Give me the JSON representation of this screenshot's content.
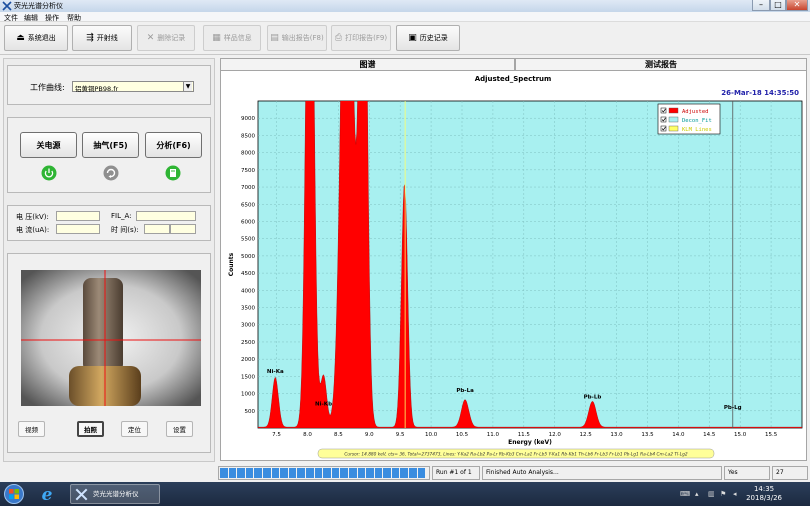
{
  "window": {
    "title": "荧光光谱分析仪",
    "minimize": "–",
    "maximize": "□",
    "close": "✕"
  },
  "menu": [
    "文件",
    "编辑",
    "操作",
    "帮助"
  ],
  "toolbar": {
    "system_exit": "系统退出",
    "xray_on": "开射线",
    "delete_record": "删除记录",
    "sample_info": "样品信息",
    "export_report": "输出报告(F8)",
    "print_report": "打印报告(F9)",
    "history": "历史记录"
  },
  "left": {
    "curve_label": "工作曲线:",
    "curve_value": "铝黄铜PB98.fr",
    "power_off": "关电源",
    "pump": "抽气(F5)",
    "analyze": "分析(F6)",
    "voltage_label": "电 压(kV):",
    "current_label": "电 流(uA):",
    "fil_label": "FIL_A:",
    "time_label": "时 间(s):",
    "video": "视频",
    "photo": "拍照",
    "locate": "定位",
    "settings": "设置"
  },
  "tabs": {
    "spectrum": "图谱",
    "report": "测试报告"
  },
  "chart_data": {
    "type": "area",
    "title": "Adjusted_Spectrum",
    "timestamp": "26-Mar-18  14:35:50",
    "xlabel": "Energy (keV)",
    "ylabel": "Counts",
    "xlim": [
      7.2,
      16.0
    ],
    "ylim": [
      0,
      9500
    ],
    "xticks": [
      "7.5",
      "8.0",
      "8.5",
      "9.0",
      "9.5",
      "10.0",
      "10.5",
      "11.0",
      "11.5",
      "12.0",
      "12.5",
      "13.0",
      "13.5",
      "14.0",
      "14.5",
      "15.0",
      "15.5"
    ],
    "yticks": [
      "500",
      "1000",
      "1500",
      "2000",
      "2500",
      "3000",
      "3500",
      "4000",
      "4500",
      "5000",
      "5500",
      "6000",
      "6500",
      "7000",
      "7500",
      "8000",
      "8500",
      "9000"
    ],
    "legend": [
      "Adjusted",
      "Decon_Fit",
      "KLM Lines"
    ],
    "legend_position": "top-right",
    "cursor_x": 14.88,
    "cursor_line_x": 9.58,
    "peaks": [
      {
        "center": 7.48,
        "height": 1450,
        "width": 0.05
      },
      {
        "center": 8.04,
        "height": 19000,
        "width": 0.06
      },
      {
        "center": 8.26,
        "height": 1500,
        "width": 0.05
      },
      {
        "center": 8.64,
        "height": 19000,
        "width": 0.09
      },
      {
        "center": 8.9,
        "height": 19000,
        "width": 0.06
      },
      {
        "center": 9.57,
        "height": 7100,
        "width": 0.05
      },
      {
        "center": 10.55,
        "height": 800,
        "width": 0.06
      },
      {
        "center": 12.61,
        "height": 750,
        "width": 0.06
      }
    ],
    "annotations": [
      {
        "label": "Ni-Ka",
        "x": 7.48,
        "y": 1600
      },
      {
        "label": "Ni-Kb",
        "x": 8.26,
        "y": 650
      },
      {
        "label": "Pb-La",
        "x": 10.55,
        "y": 1050
      },
      {
        "label": "Pb-Lb",
        "x": 12.61,
        "y": 850
      },
      {
        "label": "Pb-Lg",
        "x": 14.88,
        "y": 550
      }
    ],
    "cursor_info": "Cursor: 14.880 keV, cts= 36, Total=2737473, Lines: Y-Ka2 Ra-Lb2 Pa-Lr Rb-Kb3 Cm-La1 Fr-Lb5 Y-Ka1 Rb-Kb1 Th-Lb6 Fr-Lb3 Fr-Lb1 Pb-Lg1 Ra-Lb4 Cm-La2 Tl-Lg2"
  },
  "status": {
    "run": "Run #1 of 1",
    "message": "Finished Auto Analysis...",
    "yes": "Yes",
    "count": "27"
  },
  "taskbar": {
    "app": "荧光光谱分析仪",
    "time": "14:35",
    "date": "2018/3/26"
  },
  "colors": {
    "plot_bg": "#a8f0f0",
    "peak": "#ff0000",
    "accent": "#2a6fd6"
  }
}
